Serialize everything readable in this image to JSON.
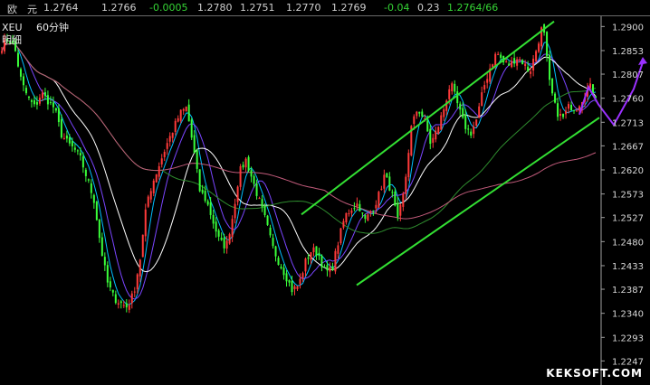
{
  "quote_bar": {
    "name": "欧　元",
    "fields": [
      {
        "value": "1.2764",
        "color": "#d0d0d0"
      },
      {
        "value": "1.2766",
        "color": "#d0d0d0"
      },
      {
        "value": "-0.0005",
        "color": "#35d435"
      },
      {
        "value": "1.2780",
        "color": "#d0d0d0"
      },
      {
        "value": "1.2751",
        "color": "#d0d0d0"
      },
      {
        "value": "1.2770",
        "color": "#d0d0d0"
      },
      {
        "value": "1.2769",
        "color": "#d0d0d0"
      },
      {
        "value": "-0.04",
        "color": "#35d435"
      },
      {
        "value": "0.23",
        "color": "#d0d0d0"
      },
      {
        "value": "1.2764/66",
        "color": "#35d435"
      }
    ]
  },
  "chart_label": {
    "symbol": "XEU",
    "period": "60分钟",
    "line2": "明细"
  },
  "watermark": "KEKSOFT.COM",
  "colors": {
    "background": "#000000",
    "bull_candle": "#ff3a3a",
    "bear_candle": "#3aff3a",
    "channel": "#33e033",
    "projection": "#9b30ff",
    "ma5": "#00bfff",
    "ma10": "#7a45ff",
    "ma20": "#ffffff",
    "ma60": "#2e8b2e",
    "ma120": "#c05a7a",
    "axis": "#a0a0a0"
  },
  "chart_data": {
    "type": "candlestick",
    "ylim": [
      1.22,
      1.292
    ],
    "y_ticks": [
      "1.2900",
      "1.2853",
      "1.2807",
      "1.2760",
      "1.2713",
      "1.2667",
      "1.2620",
      "1.2573",
      "1.2527",
      "1.2480",
      "1.2433",
      "1.2387",
      "1.2340",
      "1.2293",
      "1.2247"
    ],
    "close_path": [
      1.286,
      1.2878,
      1.2855,
      1.279,
      1.276,
      1.2742,
      1.277,
      1.2755,
      1.274,
      1.269,
      1.2672,
      1.266,
      1.264,
      1.26,
      1.256,
      1.247,
      1.24,
      1.237,
      1.236,
      1.2352,
      1.238,
      1.245,
      1.256,
      1.26,
      1.2635,
      1.267,
      1.27,
      1.273,
      1.2742,
      1.2665,
      1.258,
      1.256,
      1.252,
      1.248,
      1.247,
      1.253,
      1.2615,
      1.264,
      1.26,
      1.256,
      1.252,
      1.247,
      1.244,
      1.2415,
      1.2385,
      1.2395,
      1.244,
      1.2465,
      1.2455,
      1.242,
      1.2425,
      1.248,
      1.253,
      1.2545,
      1.2555,
      1.252,
      1.254,
      1.2565,
      1.261,
      1.258,
      1.252,
      1.258,
      1.27,
      1.274,
      1.272,
      1.267,
      1.27,
      1.274,
      1.279,
      1.275,
      1.271,
      1.269,
      1.272,
      1.278,
      1.282,
      1.285,
      1.283,
      1.2825,
      1.284,
      1.283,
      1.281,
      1.2855,
      1.2905,
      1.279,
      1.2735,
      1.272,
      1.2745,
      1.274,
      1.276,
      1.2785,
      1.2766
    ]
  },
  "overlays": {
    "channel_upper": [
      [
        333,
        1.2533
      ],
      [
        612,
        1.291
      ]
    ],
    "channel_lower": [
      [
        394,
        1.2395
      ],
      [
        662,
        1.2722
      ]
    ],
    "projection": [
      [
        640,
        1.2728
      ],
      [
        650,
        1.2782
      ],
      [
        661,
        1.2748
      ],
      [
        678,
        1.2708
      ],
      [
        700,
        1.2778
      ],
      [
        710,
        1.283
      ]
    ]
  }
}
